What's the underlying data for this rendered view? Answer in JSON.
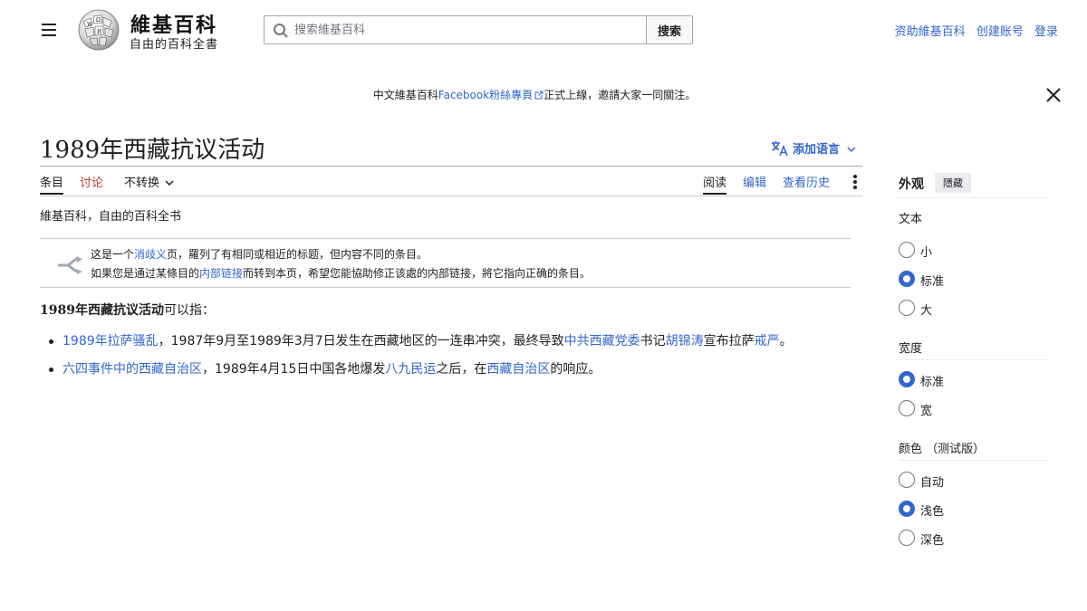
{
  "header": {
    "site_name": "維基百科",
    "tagline": "自由的百科全書",
    "search_placeholder": "搜索維基百科",
    "search_button": "搜索",
    "user_links": [
      "资助維基百科",
      "创建账号",
      "登录"
    ]
  },
  "notice": {
    "before": "中文維基百科",
    "link": "Facebook粉絲專頁",
    "after": "正式上線，邀請大家一同關注。"
  },
  "page": {
    "title": "1989年西藏抗议活动",
    "add_languages": "添加语言",
    "tabs_left": [
      "条目",
      "讨论",
      "不转换"
    ],
    "tabs_right": [
      "阅读",
      "编辑",
      "查看历史"
    ],
    "tagline": "維基百科，自由的百科全书"
  },
  "disambig": {
    "l1_a": "这是一个",
    "l1_link": "消歧义",
    "l1_b": "页，羅列了有相同或相近的标题，但内容不同的条目。",
    "l2_a": "如果您是通过某條目的",
    "l2_link": "内部链接",
    "l2_b": "而转到本页，希望您能協助修正该處的内部链接，將它指向正确的条目。"
  },
  "content": {
    "lead_bold": "1989年西藏抗议活动",
    "lead_rest": "可以指：",
    "item1": {
      "link1": "1989年拉萨骚乱",
      "t1": "，1987年9月至1989年3月7日发生在西藏地区的一连串冲突，最终导致",
      "link2": "中共西藏党委",
      "t2": "书记",
      "link3": "胡锦涛",
      "t3": "宣布拉萨",
      "link4": "戒严",
      "t4": "。"
    },
    "item2": {
      "link1": "六四事件中的西藏自治区",
      "t1": "，1989年4月15日中国各地爆发",
      "link2": "八九民运",
      "t2": "之后，在",
      "link3": "西藏自治区",
      "t3": "的响应。"
    }
  },
  "appearance": {
    "title": "外观",
    "hide": "隱藏",
    "text_title": "文本",
    "text_options": [
      "小",
      "标准",
      "大"
    ],
    "text_selected": 1,
    "width_title": "宽度",
    "width_options": [
      "标准",
      "宽"
    ],
    "width_selected": 0,
    "color_title": "颜色 （测试版）",
    "color_options": [
      "自动",
      "浅色",
      "深色"
    ],
    "color_selected": 1
  }
}
